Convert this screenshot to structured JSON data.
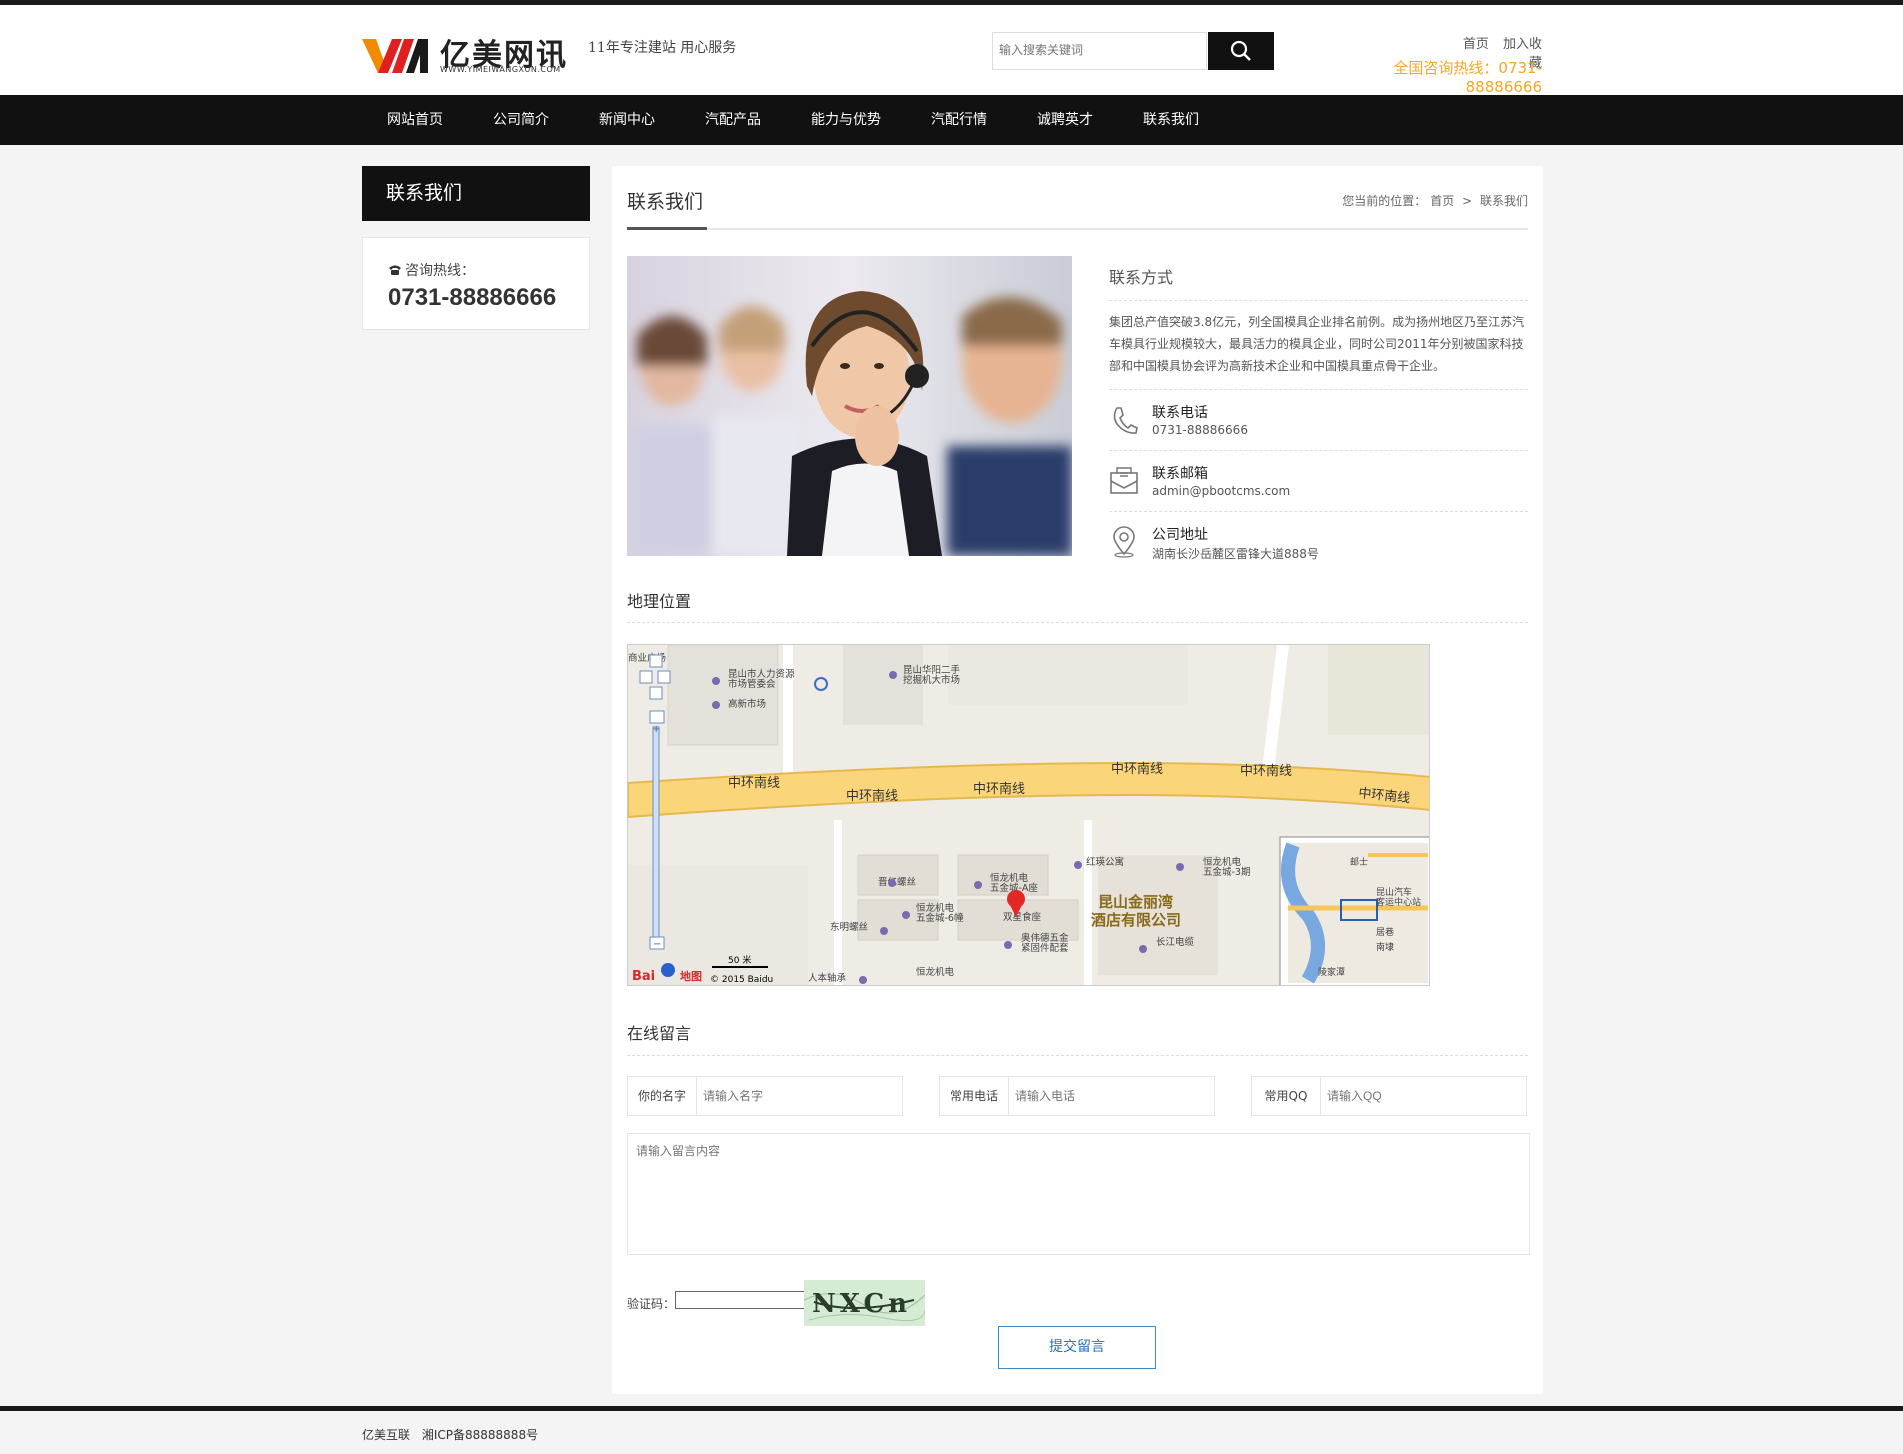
{
  "brand": {
    "logo_text": "亿美网讯",
    "logo_sub": "WWW.YIMEIWANGXUN.COM",
    "slogan": "11年专注建站 用心服务"
  },
  "search": {
    "placeholder": "输入搜索关键词"
  },
  "top_links": {
    "home": "首页",
    "favorite": "加入收藏"
  },
  "hotline_top": "全国咨询热线：0731-88886666",
  "nav": [
    "网站首页",
    "公司简介",
    "新闻中心",
    "汽配产品",
    "能力与优势",
    "汽配行情",
    "诚聘英才",
    "联系我们"
  ],
  "sidebar": {
    "title": "联系我们",
    "hotline_label": "咨询热线：",
    "hotline_number": "0731-88886666"
  },
  "main": {
    "title": "联系我们",
    "breadcrumb": {
      "prefix": "您当前的位置：",
      "home": "首页",
      "sep": ">",
      "current": "联系我们"
    }
  },
  "contact": {
    "heading": "联系方式",
    "intro": "集团总产值突破3.8亿元，列全国模具企业排名前例。成为扬州地区乃至江苏汽车模具行业规模较大，最具活力的模具企业，同时公司2011年分别被国家科技部和中国模具协会评为高新技术企业和中国模具重点骨干企业。",
    "items": [
      {
        "label": "联系电话",
        "value": "0731-88886666",
        "icon": "phone-icon"
      },
      {
        "label": "联系邮箱",
        "value": "admin@pbootcms.com",
        "icon": "mail-icon"
      },
      {
        "label": "公司地址",
        "value": "湖南长沙岳麓区雷锋大道888号",
        "icon": "location-icon"
      }
    ]
  },
  "map": {
    "title": "地理位置",
    "road": "中环南线",
    "labels": {
      "a": "商业广场",
      "b": "昆山市人力资源",
      "b2": "市场管委会",
      "c": "高新市场",
      "d": "昆山华阳二手",
      "d2": "挖掘机大市场",
      "e": "红瑛公寓",
      "f": "恒龙机电",
      "f2": "五金城-3期",
      "g": "晋亿螺丝",
      "h": "恒龙机电",
      "h2": "五金城-A座",
      "i": "恒龙机电",
      "i2": "五金城-6幢",
      "j": "双星食座",
      "k": "东明螺丝",
      "l": "奥伟德五金",
      "l2": "紧固件配套",
      "m": "长江电缆",
      "n": "人本轴承",
      "o": "恒龙机电",
      "hotel": "昆山金丽湾",
      "hotel2": "酒店有限公司",
      "mini1": "邮士",
      "mini2": "昆山汽车",
      "mini3": "客运中心站",
      "mini4": "居巷",
      "mini5": "南埭",
      "mini6": "陵家潭"
    },
    "scale": "50 米",
    "copyright": "© 2015 Baidu",
    "logo_a": "Bai",
    "logo_b": "地图"
  },
  "form": {
    "title": "在线留言",
    "name_label": "你的名字",
    "name_placeholder": "请输入名字",
    "phone_label": "常用电话",
    "phone_placeholder": "请输入电话",
    "qq_label": "常用QQ",
    "qq_placeholder": "请输入QQ",
    "content_placeholder": "请输入留言内容",
    "captcha_label": "验证码：",
    "captcha_text": "NXCn",
    "submit_label": "提交留言"
  },
  "footer": {
    "company": "亿美互联",
    "icp": "湘ICP备88888888号"
  },
  "colors": {
    "accent": "#f5a623",
    "dark": "#111111",
    "link": "#2a6fb8"
  }
}
